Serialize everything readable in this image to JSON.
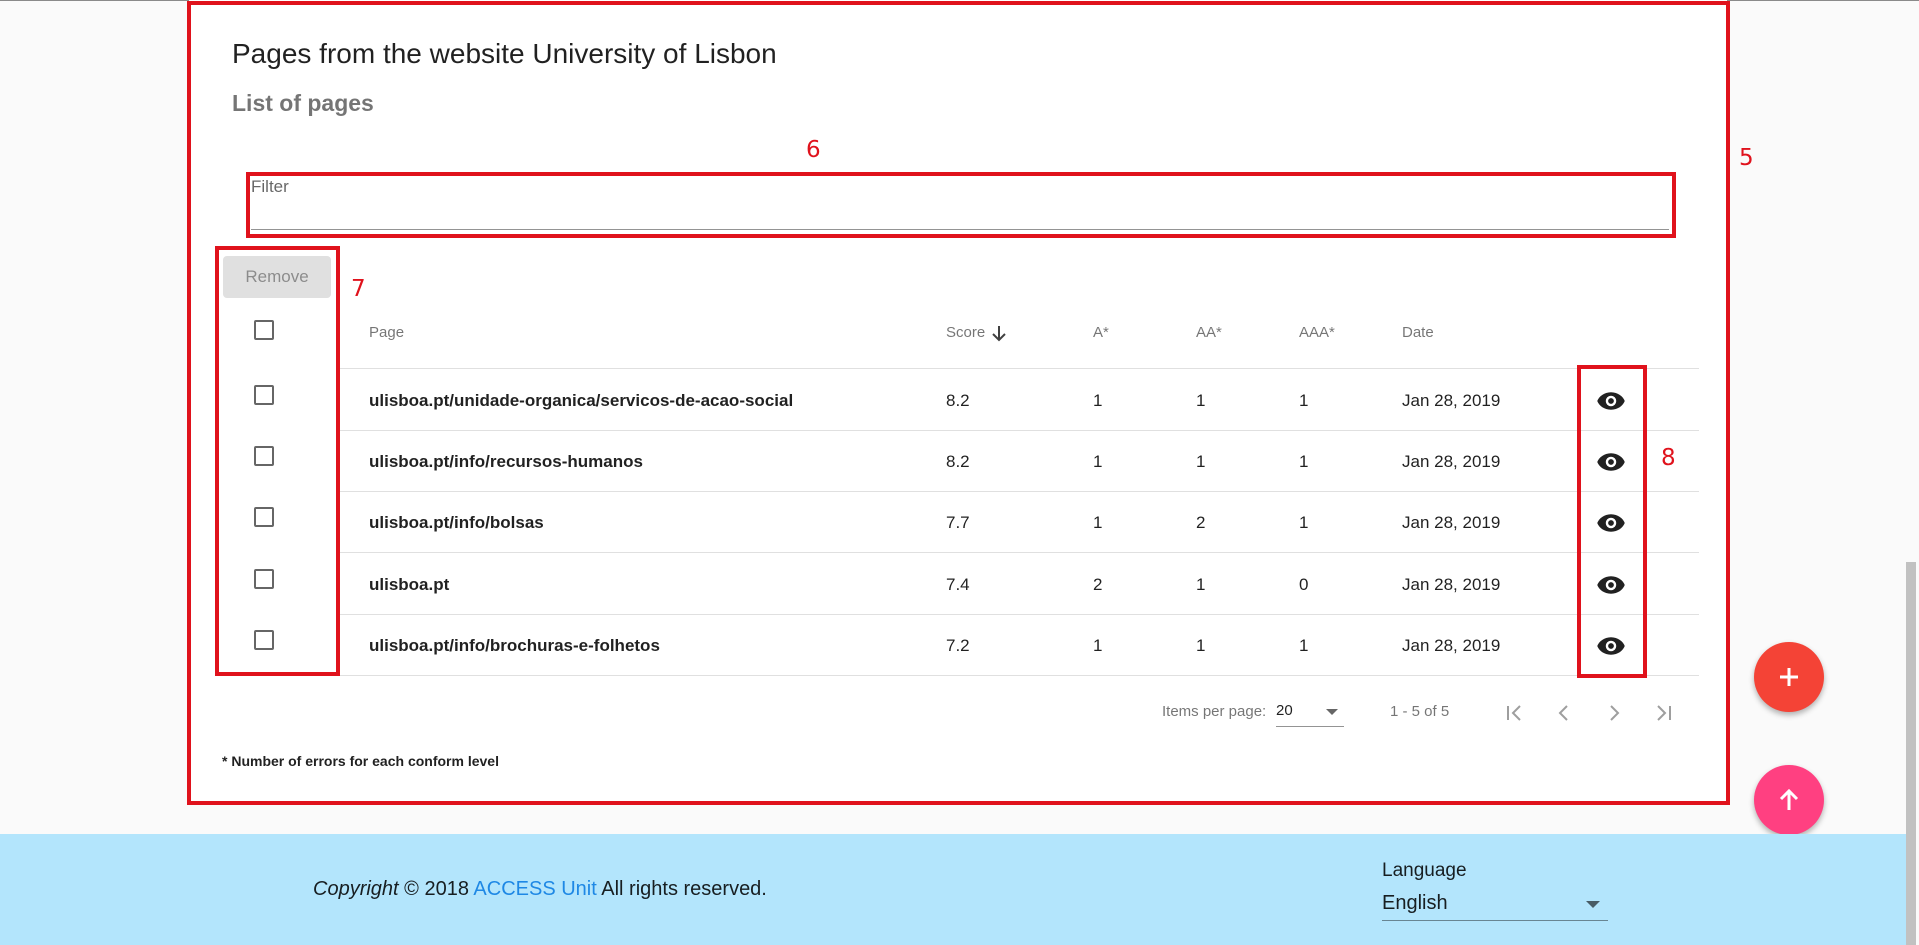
{
  "card": {
    "title": "Pages from the website University of Lisbon",
    "subtitle": "List of pages"
  },
  "filter": {
    "label": "Filter",
    "value": ""
  },
  "remove_label": "Remove",
  "table": {
    "headers": {
      "page": "Page",
      "score": "Score",
      "a": "A*",
      "aa": "AA*",
      "aaa": "AAA*",
      "date": "Date"
    },
    "sort": {
      "column": "score",
      "direction": "desc"
    },
    "rows": [
      {
        "page": "ulisboa.pt/unidade-organica/servicos-de-acao-social",
        "score": "8.2",
        "a": "1",
        "aa": "1",
        "aaa": "1",
        "date": "Jan 28, 2019"
      },
      {
        "page": "ulisboa.pt/info/recursos-humanos",
        "score": "8.2",
        "a": "1",
        "aa": "1",
        "aaa": "1",
        "date": "Jan 28, 2019"
      },
      {
        "page": "ulisboa.pt/info/bolsas",
        "score": "7.7",
        "a": "1",
        "aa": "2",
        "aaa": "1",
        "date": "Jan 28, 2019"
      },
      {
        "page": "ulisboa.pt",
        "score": "7.4",
        "a": "2",
        "aa": "1",
        "aaa": "0",
        "date": "Jan 28, 2019"
      },
      {
        "page": "ulisboa.pt/info/brochuras-e-folhetos",
        "score": "7.2",
        "a": "1",
        "aa": "1",
        "aaa": "1",
        "date": "Jan 28, 2019"
      }
    ]
  },
  "paginator": {
    "items_per_page_label": "Items per page:",
    "items_per_page": "20",
    "range": "1 - 5 of 5"
  },
  "footnote": "* Number of errors for each conform level",
  "annotations": [
    "5",
    "6",
    "7",
    "8"
  ],
  "footer": {
    "copyright_italic": "Copyright",
    "copyright_year": "© 2018",
    "link": "ACCESS Unit",
    "rights": "All rights reserved.",
    "language_label": "Language",
    "language_value": "English"
  },
  "colors": {
    "annotation": "#e0121c",
    "fab_add": "#f44336",
    "fab_up": "#ff4081",
    "footer_bg": "#b3e5fc",
    "link": "#1e88e5"
  },
  "icons": [
    "arrow-down-icon",
    "eye-icon",
    "first-page-icon",
    "prev-page-icon",
    "next-page-icon",
    "last-page-icon",
    "plus-icon",
    "arrow-up-icon",
    "dropdown-arrow-icon"
  ]
}
